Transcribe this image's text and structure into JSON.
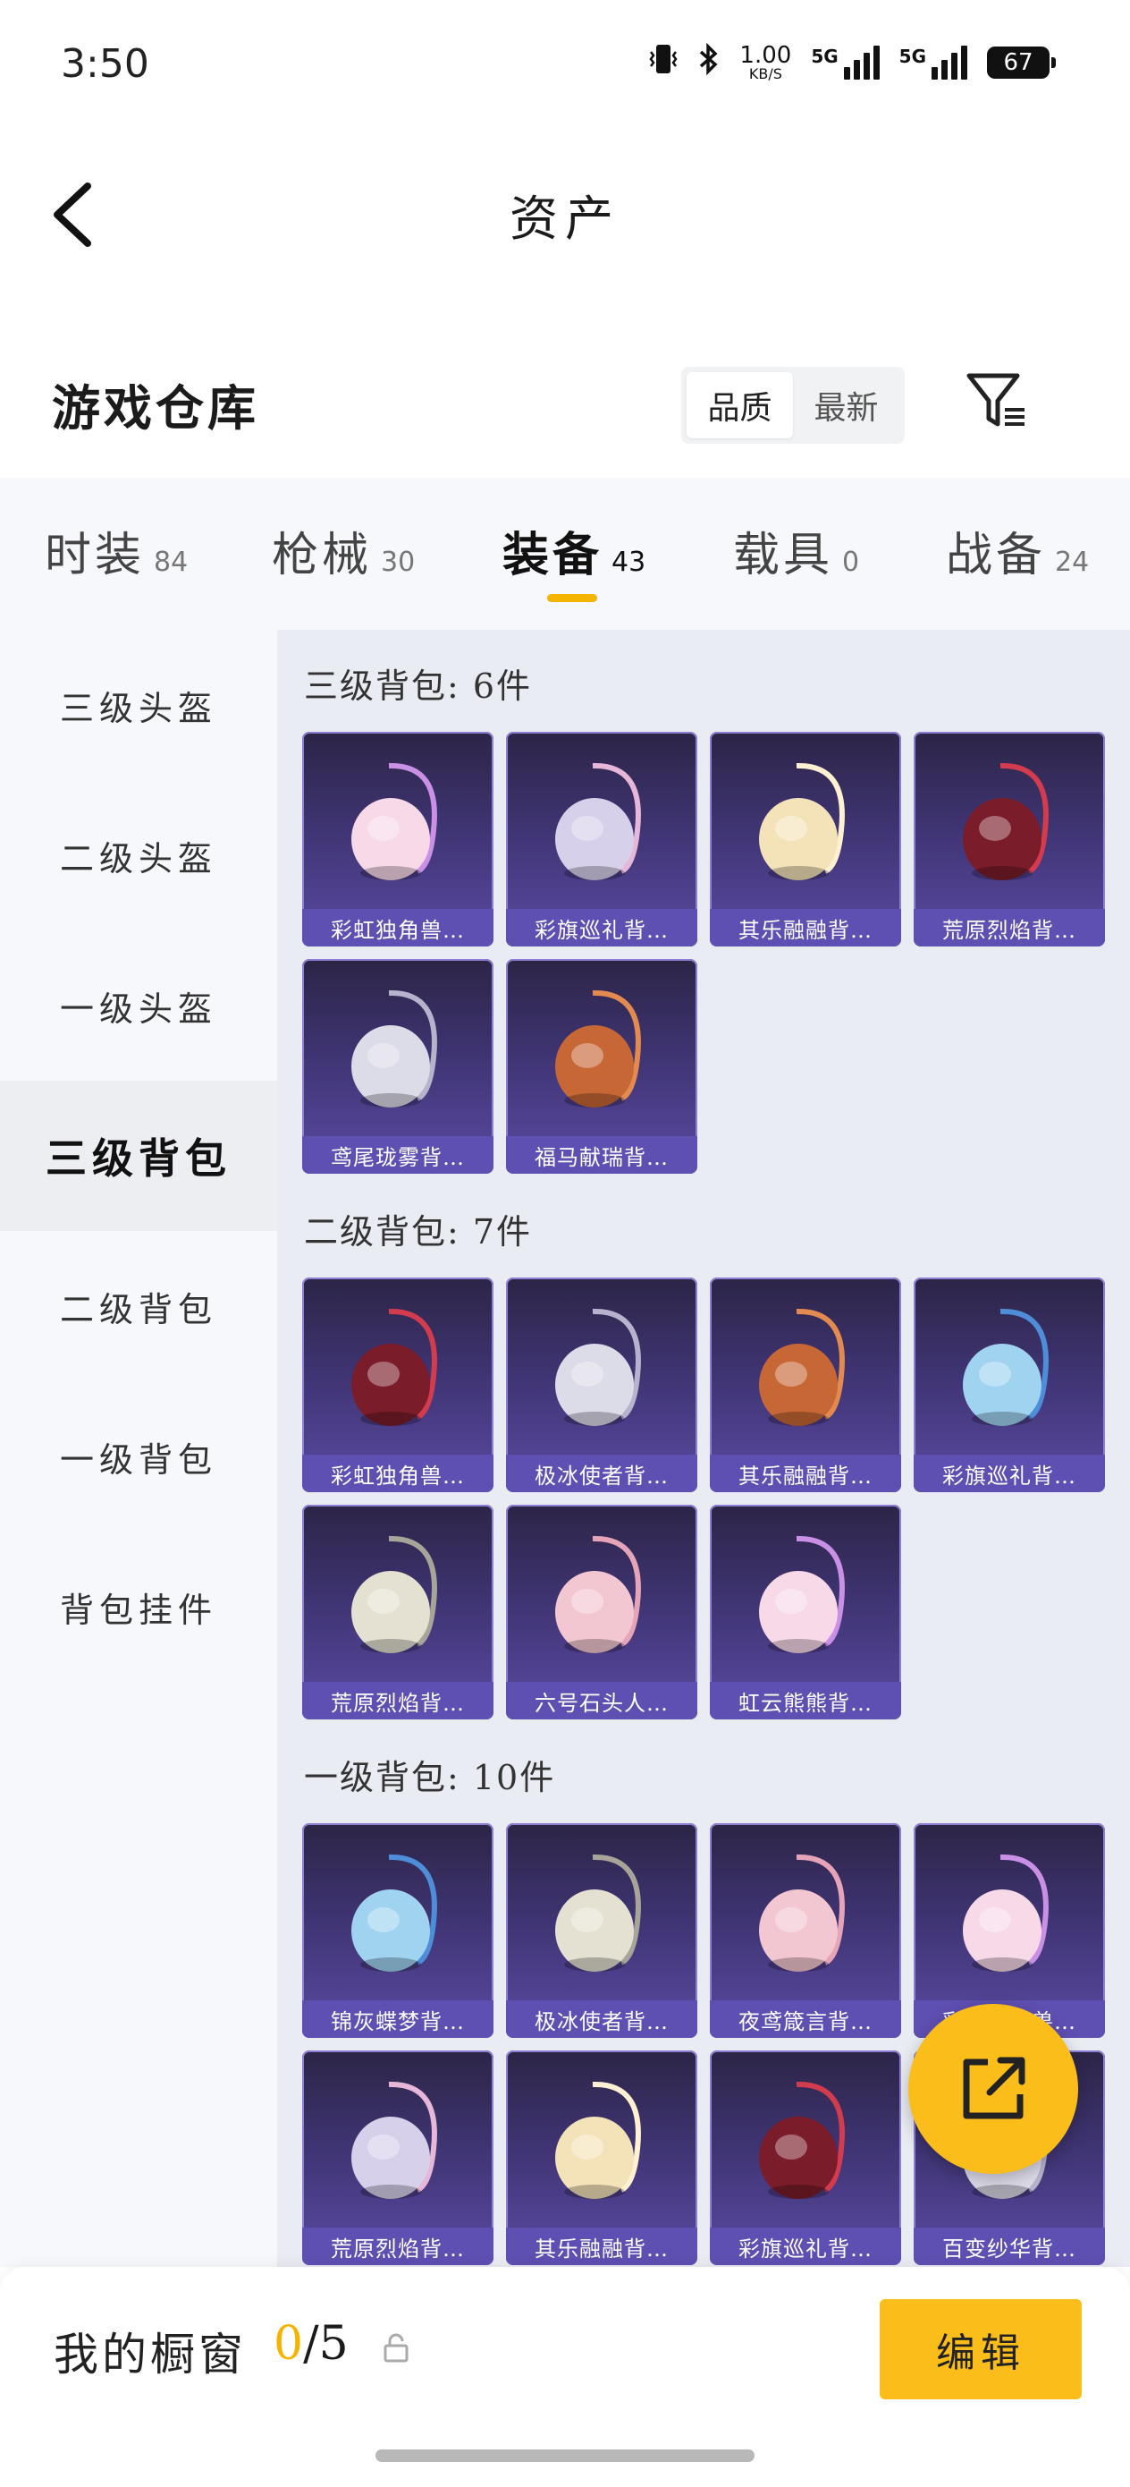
{
  "status": {
    "time": "3:50",
    "net_speed": "1.00",
    "net_unit": "KB/S",
    "sim1": "5G",
    "sim2": "5G",
    "battery": "67"
  },
  "header": {
    "title": "资产"
  },
  "warehouse": {
    "title": "游戏仓库",
    "sort_options": [
      "品质",
      "最新"
    ],
    "active_sort": "品质"
  },
  "tabs": [
    {
      "label": "时装",
      "count": "84"
    },
    {
      "label": "枪械",
      "count": "30"
    },
    {
      "label": "装备",
      "count": "43"
    },
    {
      "label": "载具",
      "count": "0"
    },
    {
      "label": "战备",
      "count": "24"
    }
  ],
  "active_tab": "装备",
  "sidebar": {
    "items": [
      "三级头盔",
      "二级头盔",
      "一级头盔",
      "三级背包",
      "二级背包",
      "一级背包",
      "背包挂件"
    ],
    "active": "三级背包"
  },
  "sections": [
    {
      "title": "三级背包: 6件",
      "items": [
        "彩虹独角兽…",
        "彩旗巡礼背…",
        "其乐融融背…",
        "荒原烈焰背…",
        "鸢尾珑雾背…",
        "福马献瑞背…"
      ]
    },
    {
      "title": "二级背包: 7件",
      "items": [
        "彩虹独角兽…",
        "极冰使者背…",
        "其乐融融背…",
        "彩旗巡礼背…",
        "荒原烈焰背…",
        "六号石头人…",
        "虹云熊熊背…"
      ]
    },
    {
      "title": "一级背包: 10件",
      "items": [
        "锦灰蝶梦背…",
        "极冰使者背…",
        "夜鸢箴言背…",
        "彩虹独角兽…",
        "荒原烈焰背…",
        "其乐融融背…",
        "彩旗巡礼背…",
        "百变纱华背…"
      ]
    }
  ],
  "bottom": {
    "label": "我的橱窗",
    "count_current": "0",
    "count_total": "/5",
    "edit_label": "编辑"
  },
  "colors": {
    "accent": "#fbbd1a",
    "card_top": "#2c2546",
    "card_label": "#5e4fb2"
  }
}
